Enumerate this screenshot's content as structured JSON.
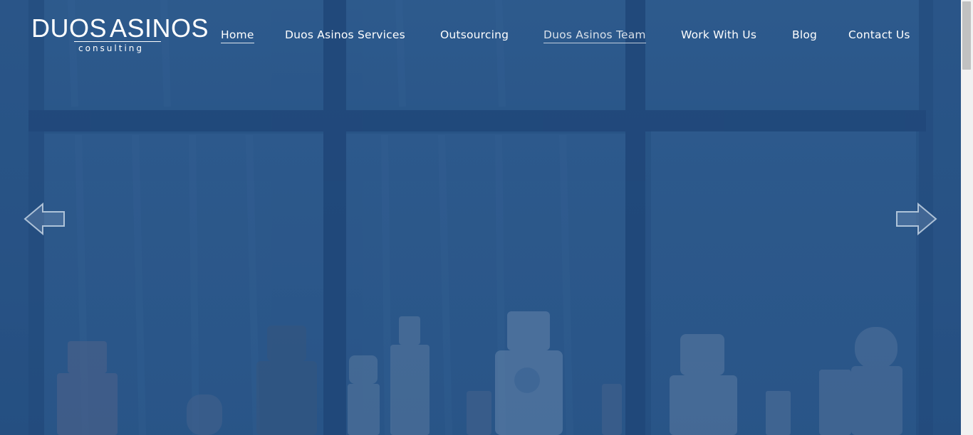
{
  "brand": {
    "name_part1": "DUOS",
    "name_part2": "ASINOS",
    "tagline": "consulting"
  },
  "nav": {
    "items": [
      {
        "label": "Home",
        "state": "active"
      },
      {
        "label": "Duos Asinos Services",
        "state": "normal"
      },
      {
        "label": "Outsourcing",
        "state": "normal"
      },
      {
        "label": "Duos Asinos Team",
        "state": "hover"
      },
      {
        "label": "Work With Us",
        "state": "normal"
      },
      {
        "label": "Blog",
        "state": "normal"
      },
      {
        "label": "Contact Us",
        "state": "normal"
      }
    ]
  },
  "slider": {
    "prev_icon": "arrow-left-icon",
    "next_icon": "arrow-right-icon"
  },
  "colors": {
    "overlay": "#2d5482",
    "text": "#ffffff"
  }
}
